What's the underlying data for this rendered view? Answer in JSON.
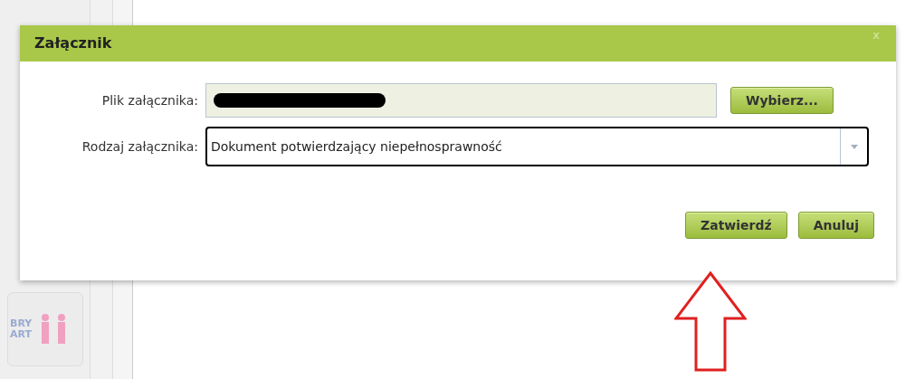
{
  "background": {
    "logo_lines": [
      "BRY",
      "ART"
    ]
  },
  "dialog": {
    "title": "Załącznik",
    "close": "x",
    "file_field": {
      "label": "Plik załącznika:",
      "redacted": true,
      "button": "Wybierz..."
    },
    "type_field": {
      "label": "Rodzaj załącznika:",
      "value": "Dokument potwierdzający niepełnosprawność",
      "focused": true
    },
    "buttons": [
      "Zatwierdź",
      "Anuluj"
    ]
  },
  "annotation": {
    "kind": "up-arrow",
    "color": "#e02020"
  }
}
